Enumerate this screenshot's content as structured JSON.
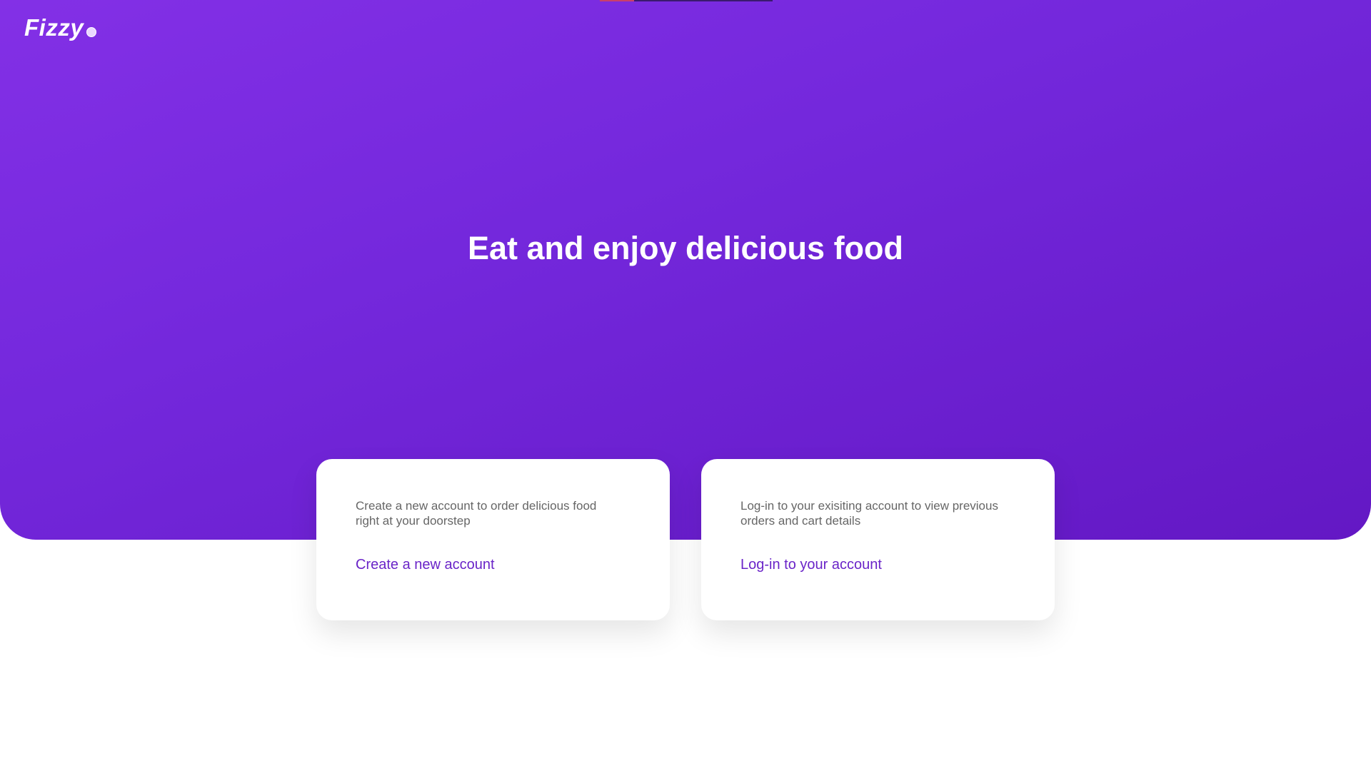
{
  "brand": {
    "name": "Fizzy",
    "logo_dot_icon": "dot-icon"
  },
  "colors": {
    "hero_gradient_start": "#8330e6",
    "hero_gradient_end": "#6318c4",
    "link": "#6a24c8",
    "card_text": "#666666"
  },
  "hero": {
    "headline": "Eat and enjoy delicious food"
  },
  "cards": [
    {
      "description": "Create a new account to order delicious food right at your doorstep",
      "link_label": "Create a new account"
    },
    {
      "description": "Log-in to your exisiting account to view previous orders and cart details",
      "link_label": "Log-in to your account"
    }
  ]
}
